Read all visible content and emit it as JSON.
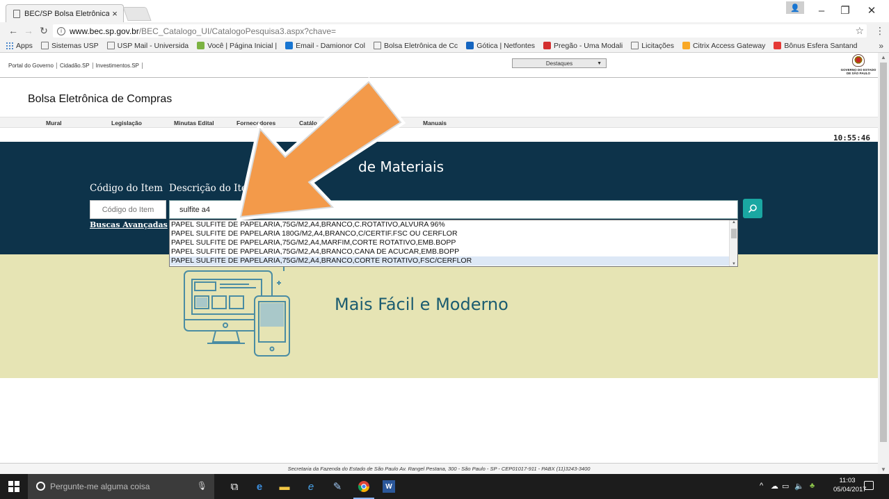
{
  "browser": {
    "tab_title": "BEC/SP Bolsa Eletrônica",
    "tab_close": "×",
    "url_host": "www.bec.sp.gov.br",
    "url_path": "/BEC_Catalogo_UI/CatalogoPesquisa3.aspx?chave=",
    "bookmarks": [
      {
        "label": "Apps",
        "icon": "apps-icon",
        "color": "#1565c0"
      },
      {
        "label": "Sistemas USP",
        "icon": "page-icon",
        "color": "#777777"
      },
      {
        "label": "USP Mail - Universida",
        "icon": "page-icon",
        "color": "#777777"
      },
      {
        "label": "Você | Página Inicial |",
        "icon": "brand-icon",
        "color": "#7cb342"
      },
      {
        "label": "Email - Damionor Col",
        "icon": "mail-icon",
        "color": "#1976d2"
      },
      {
        "label": "Bolsa Eletrônica de Cc",
        "icon": "page-icon",
        "color": "#777777"
      },
      {
        "label": "Gótica | Netfontes",
        "icon": "font-icon",
        "color": "#1565c0"
      },
      {
        "label": "Pregão - Uma Modali",
        "icon": "brand-icon",
        "color": "#d32f2f"
      },
      {
        "label": "Licitações",
        "icon": "page-icon",
        "color": "#777777"
      },
      {
        "label": "Citrix Access Gateway",
        "icon": "usp-icon",
        "color": "#f9a825"
      },
      {
        "label": "Bônus Esfera Santand",
        "icon": "santander-icon",
        "color": "#e53935"
      }
    ],
    "bookmarks_overflow": "»"
  },
  "gov": {
    "links": [
      "Portal do Governo",
      "Cidadão.SP",
      "Investimentos.SP"
    ],
    "destaques": "Destaques",
    "logo_text": "GOVERNO DO ESTADO DE SÃO PAULO"
  },
  "site": {
    "title": "Bolsa Eletrônica de Compras",
    "menu": [
      "Mural",
      "Legislação",
      "Minutas Edital",
      "Fornecedores",
      "Catálo",
      "Manuais"
    ],
    "clock": "10:55:46"
  },
  "search": {
    "hero_title": "de Materiais",
    "codigo_label": "Código do Item",
    "desc_label": "Descrição do Ite",
    "codigo_placeholder": "Código do Item",
    "desc_value": "sulfite a4",
    "advanced_link": "Buscas Avançadas",
    "suggestions": [
      "PAPEL SULFITE DE PAPELARIA,75G/M2,A4,BRANCO,C.ROTATIVO,ALVURA 96%",
      "PAPEL SULFITE DE PAPELARIA 180G/M2,A4,BRANCO,C/CERTIF.FSC OU CERFLOR",
      "PAPEL SULFITE DE PAPELARIA,75G/M2,A4,MARFIM,CORTE ROTATIVO,EMB.BOPP",
      "PAPEL SULFITE DE PAPELARIA,75G/M2,A4,BRANCO,CANA DE ACUCAR,EMB.BOPP",
      "PAPEL SULFITE DE PAPELARIA,75G/M2,A4,BRANCO,CORTE ROTATIVO,FSC/CERFLOR"
    ]
  },
  "banner": {
    "title": "Mais Fácil e Moderno"
  },
  "footer": {
    "text": "Secretaria da Fazenda do Estado de São Paulo Av. Rangel Pestana, 300 - São Paulo - SP - CEP01017-911 - PABX (11)3243-3400"
  },
  "taskbar": {
    "search_placeholder": "Pergunte-me alguma coisa",
    "time": "11:03",
    "date": "05/04/2017"
  },
  "colors": {
    "hero": "#0d334a",
    "band": "#e6e4b4",
    "accent_button": "#1aa7a2",
    "arrow": "#f39a4a"
  }
}
